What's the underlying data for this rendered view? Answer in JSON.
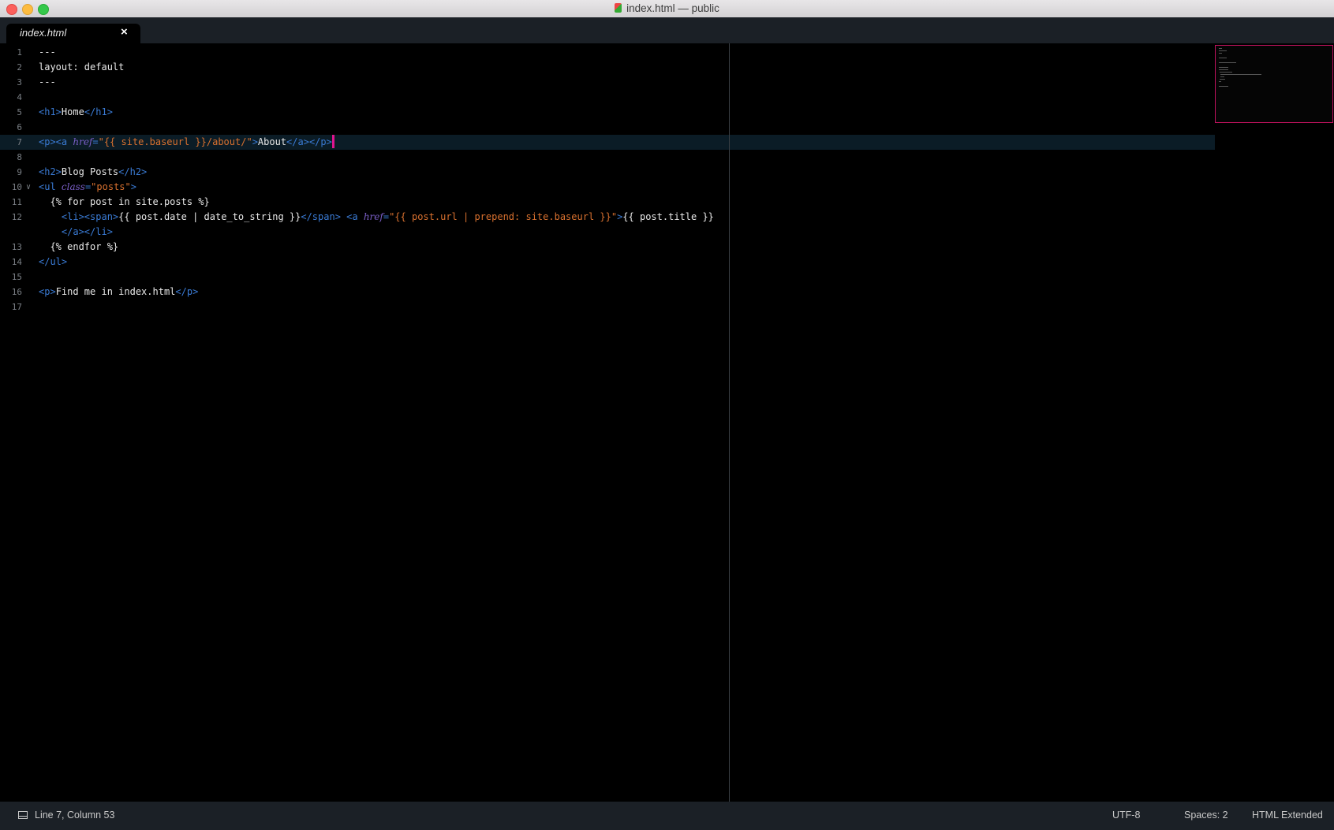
{
  "window": {
    "title": "index.html — public"
  },
  "tabs": [
    {
      "label": "index.html",
      "close": "×",
      "active": true
    }
  ],
  "editor": {
    "current_line": 7,
    "lines": [
      {
        "n": "1",
        "parts": [
          [
            "txt",
            "---"
          ]
        ]
      },
      {
        "n": "2",
        "parts": [
          [
            "txt",
            "layout: default"
          ]
        ]
      },
      {
        "n": "3",
        "parts": [
          [
            "txt",
            "---"
          ]
        ]
      },
      {
        "n": "4",
        "parts": []
      },
      {
        "n": "5",
        "parts": [
          [
            "tag",
            "<h1>"
          ],
          [
            "txt",
            "Home"
          ],
          [
            "tag",
            "</h1>"
          ]
        ]
      },
      {
        "n": "6",
        "parts": []
      },
      {
        "n": "7",
        "parts": [
          [
            "tag",
            "<p><a "
          ],
          [
            "attr",
            "href"
          ],
          [
            "tag",
            "="
          ],
          [
            "str",
            "\"{{ site.baseurl }}/about/\""
          ],
          [
            "tag",
            ">"
          ],
          [
            "txt",
            "About"
          ],
          [
            "tag",
            "</a></p>"
          ]
        ]
      },
      {
        "n": "8",
        "parts": []
      },
      {
        "n": "9",
        "parts": [
          [
            "tag",
            "<h2>"
          ],
          [
            "txt",
            "Blog Posts"
          ],
          [
            "tag",
            "</h2>"
          ]
        ]
      },
      {
        "n": "10",
        "parts": [
          [
            "tag",
            "<ul "
          ],
          [
            "attr",
            "class"
          ],
          [
            "tag",
            "="
          ],
          [
            "str",
            "\"posts\""
          ],
          [
            "tag",
            ">"
          ]
        ]
      },
      {
        "n": "11",
        "parts": [
          [
            "txt",
            "  {% for post in site.posts %}"
          ]
        ]
      },
      {
        "n": "12",
        "parts": [
          [
            "txt",
            "    "
          ],
          [
            "tag",
            "<li><span>"
          ],
          [
            "txt",
            "{{ post.date | date_to_string }}"
          ],
          [
            "tag",
            "</span> <a "
          ],
          [
            "attr",
            "href"
          ],
          [
            "tag",
            "="
          ],
          [
            "str",
            "\"{{ post.url | prepend: site.baseurl }}\""
          ],
          [
            "tag",
            ">"
          ],
          [
            "txt",
            "{{ post.title }}"
          ]
        ]
      },
      {
        "n": "",
        "parts": [
          [
            "txt",
            "    "
          ],
          [
            "tag",
            "</a></li>"
          ]
        ]
      },
      {
        "n": "13",
        "parts": [
          [
            "txt",
            "  {% endfor %}"
          ]
        ]
      },
      {
        "n": "14",
        "parts": [
          [
            "tag",
            "</ul>"
          ]
        ]
      },
      {
        "n": "15",
        "parts": []
      },
      {
        "n": "16",
        "parts": [
          [
            "tag",
            "<p>"
          ],
          [
            "txt",
            "Find me in index.html"
          ],
          [
            "tag",
            "</p>"
          ]
        ]
      },
      {
        "n": "17",
        "parts": []
      }
    ]
  },
  "status": {
    "position": "Line 7, Column 53",
    "encoding": "UTF-8",
    "indent": "Spaces: 2",
    "syntax": "HTML Extended"
  },
  "colors": {
    "tag": "#3a7bd5",
    "attribute": "#7a5fc7",
    "string": "#d9712f",
    "text": "#e8e8e8",
    "caret": "#e0158f",
    "minimap_border": "#c0125e"
  }
}
